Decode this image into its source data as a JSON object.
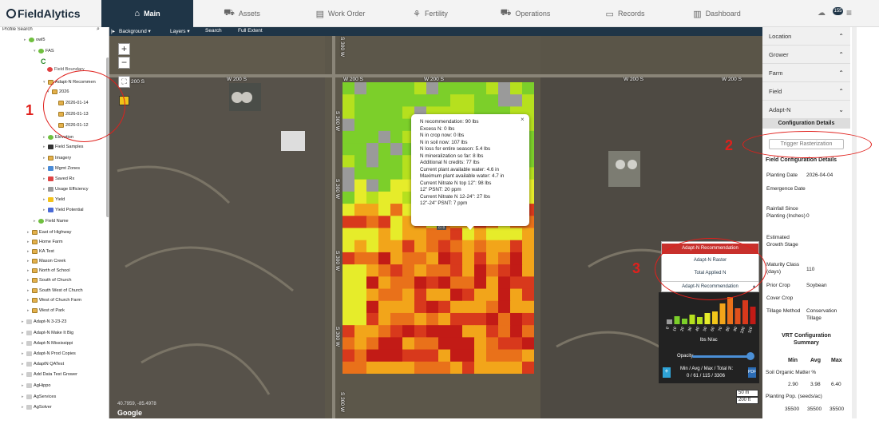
{
  "app": {
    "logo": "FieldAlytics",
    "notification_count": "155"
  },
  "nav": {
    "tabs": [
      {
        "label": "Main",
        "icon": "home-icon"
      },
      {
        "label": "Assets",
        "icon": "tractor-icon"
      },
      {
        "label": "Work Order",
        "icon": "document-icon"
      },
      {
        "label": "Fertility",
        "icon": "plant-icon"
      },
      {
        "label": "Operations",
        "icon": "truck-icon"
      },
      {
        "label": "Records",
        "icon": "folder-icon"
      },
      {
        "label": "Dashboard",
        "icon": "chart-icon"
      }
    ]
  },
  "left": {
    "search_placeholder": "Profile Search",
    "tree": [
      "owl5",
      "FAS",
      "C",
      "Field Boundary",
      "Adapt-N Recommen",
      "2026",
      "2026-01-14",
      "2026-01-13",
      "2026-01-12",
      "Elevation",
      "Field Samples",
      "Imagery",
      "Mgmt Zones",
      "Saved Rx",
      "Usage Efficiency",
      "Yield",
      "Yield Potential",
      "Field Name",
      "East of Highway",
      "Home Farm",
      "KA Test",
      "Mason Creek",
      "North of School",
      "South of Church",
      "South West of Church",
      "West of Church Farm",
      "West of Park",
      "Adapt-N 3-23-23",
      "Adapt-N Make It Big",
      "Adapt-N Mississippi",
      "Adapt-N Prod Copies",
      "AdaptN QATest",
      "Add Data Test Grower",
      "AgHippo",
      "AgServices",
      "AgSolver"
    ]
  },
  "map": {
    "toolbar": [
      "Background ▾",
      "Layers ▾",
      "Search",
      "Full Extent"
    ],
    "roads": {
      "w200s": "W 200 S",
      "s300w": "S 300 W",
      "w200s_left": "200 S"
    },
    "zoom_in": "+",
    "zoom_out": "−",
    "fullscreen": "⛶",
    "marker": "878",
    "popup": [
      "N recommendation: 90 lbs",
      "Excess N: 0 lbs",
      "N in crop now: 0 lbs",
      "N in soil now: 107 lbs",
      "N loss for entire season: 5.4 lbs",
      "N mineralization so far: 8 lbs",
      "Additional N credits: 77 lbs",
      "Current plant available water: 4.6 in",
      "Maximum plant available water: 4.7 in",
      "Current Nitrate N top 12\": 98 lbs",
      "12\" PSNT: 20 ppm",
      "Current Nitrate N 12-24\": 27 lbs",
      "12\"-24\" PSNT: 7 ppm"
    ],
    "popup_close": "×",
    "layers": [
      "Adapt-N Recommendation",
      "Adapt-N Raster",
      "Total Applied N"
    ],
    "layer_selected": "Adapt-N Recommendation",
    "legend": {
      "ticks": [
        "0",
        "10",
        "20",
        "30",
        "40",
        "50",
        "60",
        "70",
        "80",
        "90",
        "100",
        "110"
      ],
      "unit": "lbs N/ac",
      "opacity_label": "Opacity",
      "opacity_value": 0.95,
      "stats_label": "Min / Avg / Max / Total N:",
      "stats_value": "0 / 61 / 115 / 3306"
    },
    "scale": {
      "metric": "50 m",
      "imperial": "200 ft"
    },
    "coords": "40.7959, -85.4978",
    "attribution": "Google"
  },
  "right": {
    "accordion": [
      "Location",
      "Grower",
      "Farm",
      "Field",
      "Adapt-N"
    ],
    "config_details": "Configuration Details",
    "trigger": "Trigger Rasterization",
    "field_config_title": "Field Configuration Details",
    "fields": [
      {
        "k": "Planting Date",
        "v": "2026-04-04"
      },
      {
        "k": "Emergence Date",
        "v": ""
      },
      {
        "k": "Rainfall Since Planting (Inches)",
        "v": "0"
      },
      {
        "k": "Estimated Growth Stage",
        "v": ""
      },
      {
        "k": "Maturity Class (days)",
        "v": "110"
      },
      {
        "k": "Prior Crop",
        "v": "Soybean"
      },
      {
        "k": "Cover Crop",
        "v": ""
      },
      {
        "k": "Tillage Method",
        "v": "Conservation Tillage"
      }
    ],
    "vrt_title": "VRT Configuration Summary",
    "vrt_cols": [
      "Min",
      "Avg",
      "Max"
    ],
    "som_label": "Soil Organic Matter %",
    "som": [
      "2.90",
      "3.98",
      "6.40"
    ],
    "pop_label": "Planting Pop. (seeds/ac)",
    "pop": [
      "35500",
      "35500",
      "35500"
    ]
  },
  "annotations": [
    "1",
    "2",
    "3"
  ],
  "colors": {
    "nav": "#1f3547",
    "accent": "#c8302c",
    "annotation": "#e0201c"
  }
}
